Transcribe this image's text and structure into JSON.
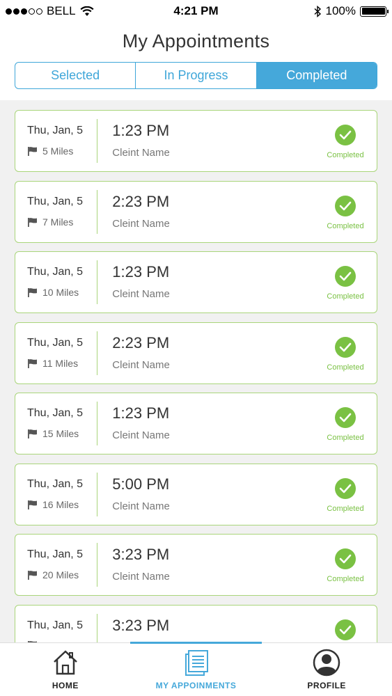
{
  "status_bar": {
    "carrier": "BELL",
    "time": "4:21 PM",
    "battery": "100%"
  },
  "header": {
    "title": "My Appointments",
    "segments": [
      {
        "label": "Selected"
      },
      {
        "label": "In Progress"
      },
      {
        "label": "Completed"
      }
    ],
    "active_segment": "Completed"
  },
  "appointments": [
    {
      "date": "Thu, Jan, 5",
      "distance": "5 Miles",
      "time": "1:23 PM",
      "client": "Cleint Name",
      "status": "Completed"
    },
    {
      "date": "Thu, Jan, 5",
      "distance": "7 Miles",
      "time": "2:23 PM",
      "client": "Cleint Name",
      "status": "Completed"
    },
    {
      "date": "Thu, Jan, 5",
      "distance": "10 Miles",
      "time": "1:23 PM",
      "client": "Cleint Name",
      "status": "Completed"
    },
    {
      "date": "Thu, Jan, 5",
      "distance": "11 Miles",
      "time": "2:23 PM",
      "client": "Cleint Name",
      "status": "Completed"
    },
    {
      "date": "Thu, Jan, 5",
      "distance": "15 Miles",
      "time": "1:23 PM",
      "client": "Cleint Name",
      "status": "Completed"
    },
    {
      "date": "Thu, Jan, 5",
      "distance": "16 Miles",
      "time": "5:00 PM",
      "client": "Cleint Name",
      "status": "Completed"
    },
    {
      "date": "Thu, Jan, 5",
      "distance": "20 Miles",
      "time": "3:23 PM",
      "client": "Cleint Name",
      "status": "Completed"
    },
    {
      "date": "Thu, Jan, 5",
      "distance": "",
      "time": "3:23 PM",
      "client": "",
      "status": ""
    }
  ],
  "tabbar": {
    "tabs": [
      {
        "label": "HOME",
        "icon": "home-icon"
      },
      {
        "label": "MY APPOINMENTS",
        "icon": "appointments-icon"
      },
      {
        "label": "PROFILE",
        "icon": "profile-icon"
      }
    ],
    "active_tab": "MY APPOINMENTS"
  },
  "colors": {
    "accent": "#45a8da",
    "success": "#7ac143",
    "card_border": "#a9d57a"
  }
}
